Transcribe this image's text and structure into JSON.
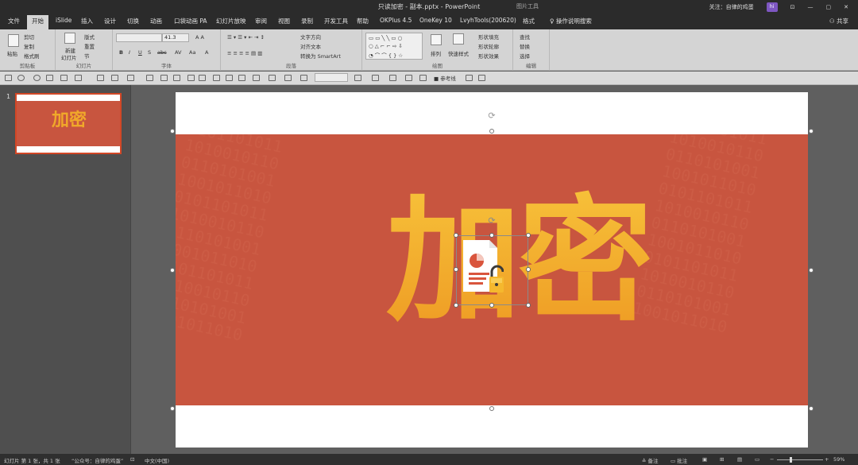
{
  "window": {
    "title": "只读加密 - 副本.pptx  -  PowerPoint",
    "picture_tools": "图片工具",
    "user": "关注：自律的鸡蛋",
    "avatar_text": "hi",
    "minimize": "—",
    "restore": "▢",
    "close": "✕",
    "ribbon_opts": "⊡"
  },
  "tabs": [
    {
      "label": "文件"
    },
    {
      "label": "开始"
    },
    {
      "label": "iSlide"
    },
    {
      "label": "插入"
    },
    {
      "label": "设计"
    },
    {
      "label": "切换"
    },
    {
      "label": "动画"
    },
    {
      "label": "口袋动画 PA"
    },
    {
      "label": "幻灯片放映"
    },
    {
      "label": "审阅"
    },
    {
      "label": "视图"
    },
    {
      "label": "录制"
    },
    {
      "label": "开发工具"
    },
    {
      "label": "帮助"
    },
    {
      "label": "OKPlus 4.5"
    },
    {
      "label": "OneKey 10"
    },
    {
      "label": "LvyhTools(200620)"
    },
    {
      "label": "格式"
    }
  ],
  "tell_me": "操作说明搜索",
  "share": "共享",
  "ribbon": {
    "clipboard": {
      "label": "剪贴板",
      "paste": "粘贴",
      "cut": "剪切",
      "copy": "复制",
      "format_painter": "格式刷"
    },
    "slides": {
      "label": "幻灯片",
      "new_slide": "新建",
      "new_slide2": "幻灯片",
      "layout": "版式",
      "reset": "重置",
      "section": "节"
    },
    "font": {
      "label": "字体",
      "size": "41.3",
      "bold": "B",
      "italic": "I",
      "underline": "U",
      "strike": "S",
      "shadow": "abc",
      "spacing": "AV",
      "case": "Aa",
      "color": "A"
    },
    "paragraph": {
      "label": "段落",
      "text_direction": "文字方向",
      "align_text": "对齐文本",
      "smartart": "转换为 SmartArt"
    },
    "drawing": {
      "label": "绘图",
      "arrange": "排列",
      "quick_styles": "快速样式",
      "shape_fill": "形状填充",
      "shape_outline": "形状轮廓",
      "shape_effects": "形状效果"
    },
    "editing": {
      "label": "编辑",
      "find": "查找",
      "replace": "替换",
      "select": "选择"
    }
  },
  "qat": {
    "ref_line": "参考线"
  },
  "thumbnail": {
    "number": "1",
    "text": "加密"
  },
  "slide": {
    "title_text": "加密",
    "binary": "0101101011\n1010010110\n0110101001\n1001011010\n0101101011\n1010010110\n0110101001\n1001011010\n0101101011\n1010010110\n0110101001\n1001011010"
  },
  "status": {
    "slide_info": "幻灯片 第 1 张，共 1 张",
    "author": "“公众号：自律的鸡蛋”",
    "lang": "中文(中国)",
    "notes": "备注",
    "comments": "批注",
    "zoom": "59%"
  },
  "colors": {
    "accent": "#c8553f",
    "gold": "#f1a52b",
    "ribbon": "#d4d4d4",
    "titlebar": "#2b2b2b"
  }
}
